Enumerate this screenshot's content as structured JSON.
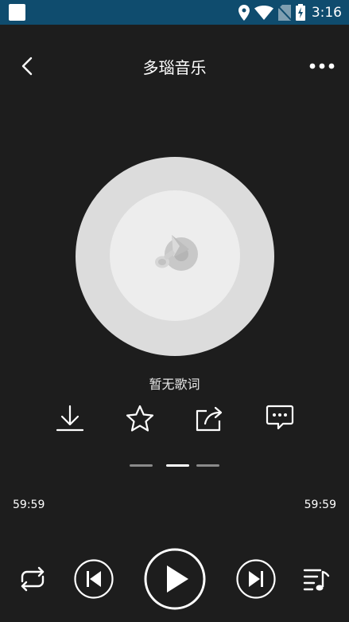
{
  "status_bar": {
    "time": "3:16",
    "icons": [
      "notification-square-icon",
      "location-icon",
      "wifi-icon",
      "no-sim-icon",
      "battery-charging-icon"
    ],
    "background": "#0f4c6e"
  },
  "header": {
    "title": "多瑙音乐",
    "back_icon": "chevron-left-icon",
    "more_icon": "more-horizontal-icon"
  },
  "album": {
    "icon": "music-app-logo-icon"
  },
  "lyrics": {
    "text": "暂无歌词"
  },
  "actions": [
    {
      "name": "download",
      "icon": "download-icon"
    },
    {
      "name": "favorite",
      "icon": "star-outline-icon"
    },
    {
      "name": "share",
      "icon": "share-icon"
    },
    {
      "name": "comment",
      "icon": "comment-icon"
    }
  ],
  "pager": {
    "count": 3,
    "active_index": 1
  },
  "progress": {
    "current_time": "59:59",
    "total_time": "59:59"
  },
  "controls": [
    {
      "name": "repeat",
      "icon": "repeat-icon"
    },
    {
      "name": "previous",
      "icon": "skip-previous-icon"
    },
    {
      "name": "play",
      "icon": "play-icon"
    },
    {
      "name": "next",
      "icon": "skip-next-icon"
    },
    {
      "name": "playlist",
      "icon": "playlist-music-icon"
    }
  ],
  "colors": {
    "background": "#1d1d1d",
    "accent": "#ffffff"
  }
}
